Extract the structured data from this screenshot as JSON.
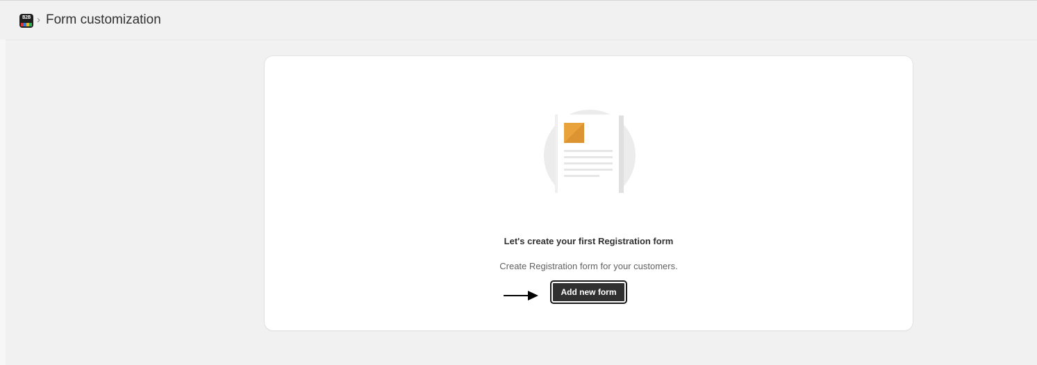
{
  "header": {
    "app_logo_icon": "b2b-app-logo-icon",
    "app_logo_text": "B2B",
    "breadcrumb_separator": "›",
    "title": "Form customization"
  },
  "empty_state": {
    "illustration_icon": "document-illustration-icon",
    "heading": "Let's create your first Registration form",
    "description": "Create Registration form for your customers.",
    "pointer_icon": "arrow-right-icon",
    "button_label": "Add new form"
  },
  "colors": {
    "page_background": "#f1f1f1",
    "card_background": "#ffffff",
    "button_background": "#303030",
    "illustration_accent": "#e8a33d"
  }
}
